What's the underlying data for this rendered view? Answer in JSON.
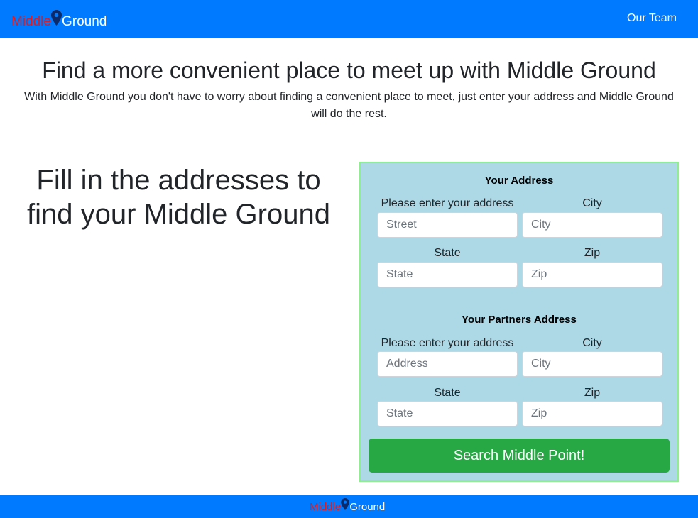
{
  "navbar": {
    "brand_part1": "Middle",
    "brand_part2": "Ground",
    "brand_icon": "map-pin-icon",
    "link_team": "Our Team"
  },
  "hero": {
    "title": "Find a more convenient place to meet up with Middle Ground",
    "subtitle": "With Middle Ground you don't have to worry about finding a convenient place to meet, just enter your address and Middle Ground will do the rest."
  },
  "left_heading": "Fill in the addresses to find your Middle Ground",
  "form": {
    "your_address": {
      "title": "Your Address",
      "address_label": "Please enter your address",
      "address_placeholder": "Street",
      "city_label": "City",
      "city_placeholder": "City",
      "state_label": "State",
      "state_placeholder": "State",
      "zip_label": "Zip",
      "zip_placeholder": "Zip"
    },
    "partner_address": {
      "title": "Your Partners Address",
      "address_label": "Please enter your address",
      "address_placeholder": "Address",
      "city_label": "City",
      "city_placeholder": "City",
      "state_label": "State",
      "state_placeholder": "State",
      "zip_label": "Zip",
      "zip_placeholder": "Zip"
    },
    "submit_label": "Search Middle Point!"
  },
  "footer": {
    "brand_part1": "Middle",
    "brand_part2": "Ground",
    "brand_icon": "map-pin-icon"
  },
  "colors": {
    "nav_bg": "#007bff",
    "brand_red": "#d0202f",
    "form_bg": "#add8e6",
    "form_border": "#90ee90",
    "button_green": "#28a745"
  }
}
